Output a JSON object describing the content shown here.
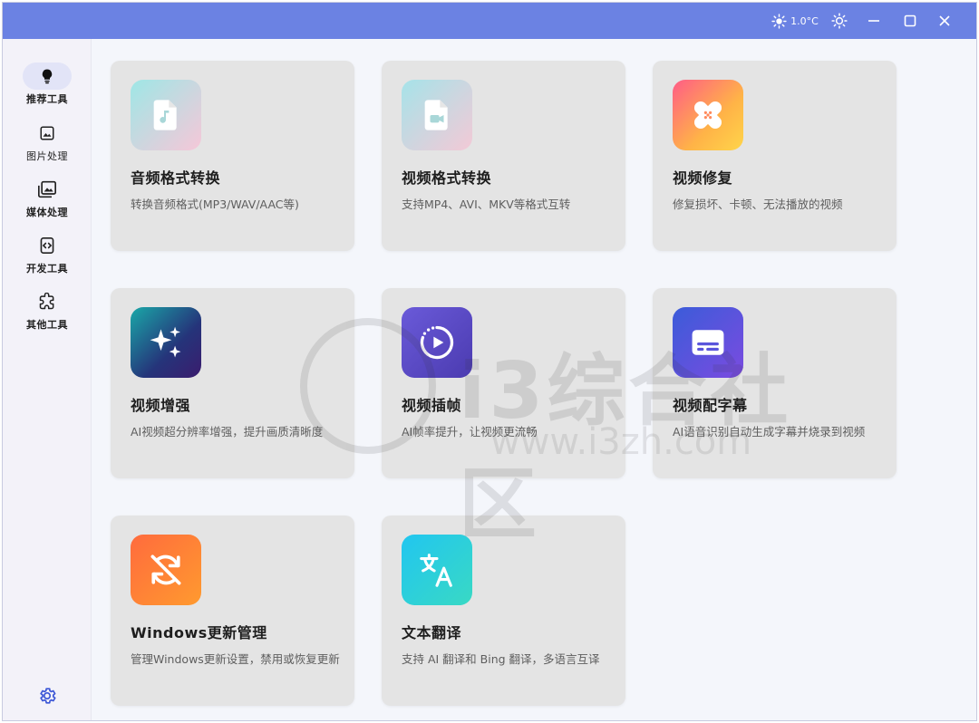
{
  "titlebar": {
    "temperature": "1.0°C",
    "accent": "#6b82e3"
  },
  "sidebar": {
    "items": [
      {
        "label": "推荐工具",
        "icon": "lightbulb-icon",
        "active": true
      },
      {
        "label": "图片处理",
        "icon": "image-icon",
        "active": false
      },
      {
        "label": "媒体处理",
        "icon": "gallery-icon",
        "active": false
      },
      {
        "label": "开发工具",
        "icon": "code-icon",
        "active": false
      },
      {
        "label": "其他工具",
        "icon": "puzzle-icon",
        "active": false
      }
    ],
    "settings_icon": "gear-icon"
  },
  "cards": [
    {
      "title": "音频格式转换",
      "desc": "转换音频格式(MP3/WAV/AAC等)",
      "icon": "audio-file-icon"
    },
    {
      "title": "视频格式转换",
      "desc": "支持MP4、AVI、MKV等格式互转",
      "icon": "video-file-icon"
    },
    {
      "title": "视频修复",
      "desc": "修复损坏、卡顿、无法播放的视频",
      "icon": "bandage-icon"
    },
    {
      "title": "视频增强",
      "desc": "AI视频超分辨率增强，提升画质清晰度",
      "icon": "sparkle-icon"
    },
    {
      "title": "视频插帧",
      "desc": "AI帧率提升，让视频更流畅",
      "icon": "play-circle-icon"
    },
    {
      "title": "视频配字幕",
      "desc": "AI语音识别自动生成字幕并烧录到视频",
      "icon": "subtitles-icon"
    },
    {
      "title": "Windows更新管理",
      "desc": "管理Windows更新设置，禁用或恢复更新",
      "icon": "update-off-icon"
    },
    {
      "title": "文本翻译",
      "desc": "支持 AI 翻译和 Bing 翻译，多语言互译",
      "icon": "translate-icon"
    }
  ],
  "watermark": {
    "text": "i3综合社区",
    "url": "www.i3zh.com"
  }
}
